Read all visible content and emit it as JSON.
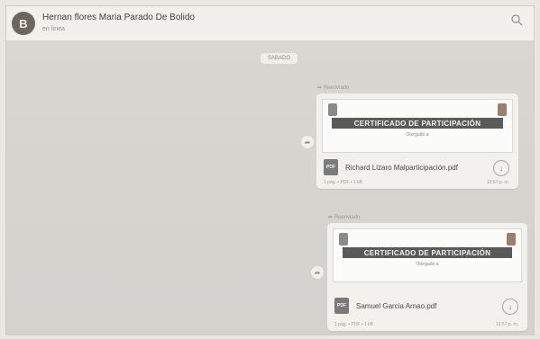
{
  "header": {
    "avatar_letter": "B",
    "contact_name": "Hernan flores Maria Parado De Bolido",
    "status": "en línea",
    "search_icon": "search-icon"
  },
  "chat": {
    "date_badge": "SABADO",
    "messages": [
      {
        "forwarded": "Reenviado",
        "banner": "CERTIFICADO DE PARTICIPACIÓN",
        "sub": "Otorgado a",
        "file_type": "PDF",
        "file_name": "Richard Lizaro Malparticipación.pdf",
        "meta": "1 pág. • PDF • 1 kB",
        "time": "12:57 p. m."
      },
      {
        "forwarded": "Reenviado",
        "banner": "CERTIFICADO DE PARTICIPACIÓN",
        "sub": "Otorgado a",
        "file_type": "PDF",
        "file_name": "Samuel Garcia Arnao.pdf",
        "meta": "1 pág. • PDF • 1 kB",
        "time": "12:57 p. m."
      }
    ]
  },
  "colors": {
    "header_bg": "#f1f0ec",
    "chat_bg": "#d6d4cf",
    "bubble_bg": "#f2f1ed",
    "banner_bg": "#5a5a5a"
  }
}
